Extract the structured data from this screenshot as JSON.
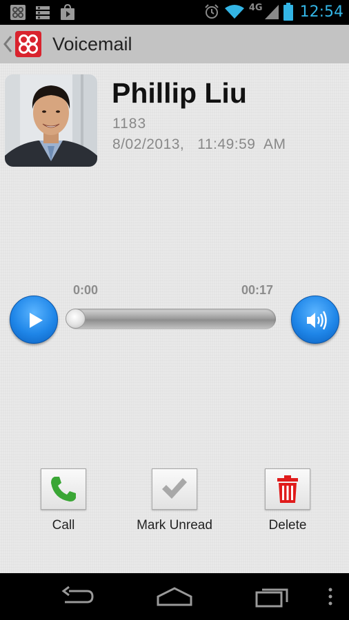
{
  "status_bar": {
    "time": "12:54",
    "network": "4G",
    "icons_left": [
      "app-grid-icon",
      "list-icon",
      "store-bag-icon"
    ],
    "icons_right": [
      "alarm-icon",
      "wifi-icon",
      "signal-icon",
      "battery-icon"
    ]
  },
  "action_bar": {
    "title": "Voicemail"
  },
  "contact": {
    "name": "Phillip Liu",
    "extension": "1183",
    "datetime": "8/02/2013,   11:49:59  AM"
  },
  "player": {
    "current_time": "0:00",
    "duration": "00:17",
    "progress": 0
  },
  "actions": [
    {
      "label": "Call",
      "icon": "phone-icon"
    },
    {
      "label": "Mark Unread",
      "icon": "checkmark-icon"
    },
    {
      "label": "Delete",
      "icon": "trash-icon"
    }
  ],
  "colors": {
    "accent_blue": "#1f86e8",
    "status_time": "#33b5e5",
    "brand_red": "#d9232e",
    "call_green": "#3aa635",
    "delete_red": "#e01b1b"
  }
}
